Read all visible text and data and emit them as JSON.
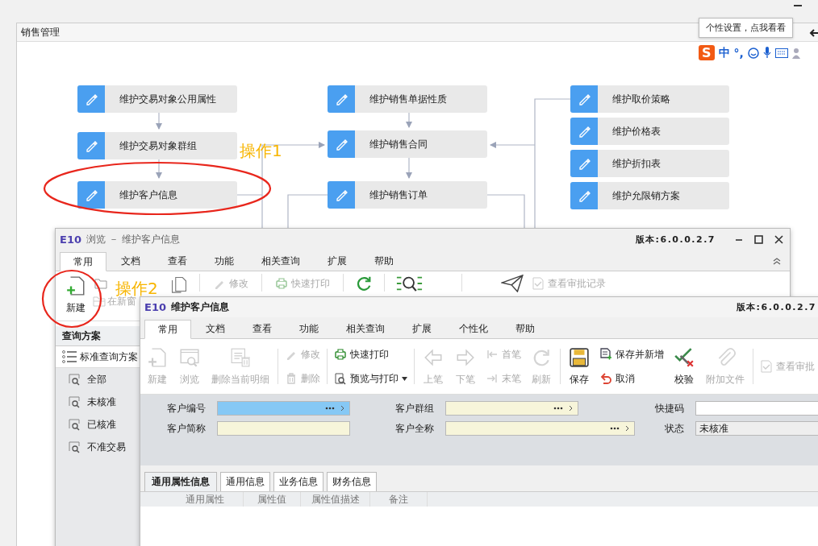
{
  "panel": {
    "title": "销售管理"
  },
  "tooltip": {
    "text": "个性设置，点我看看"
  },
  "ime_bar": {
    "logo": "S",
    "mode": "中",
    "punctuation": "°,"
  },
  "flow": {
    "columns": [
      {
        "nodes": [
          {
            "label": "维护交易对象公用属性"
          },
          {
            "label": "维护交易对象群组"
          },
          {
            "label": "维护客户信息"
          }
        ]
      },
      {
        "nodes": [
          {
            "label": "维护销售单据性质"
          },
          {
            "label": "维护销售合同"
          },
          {
            "label": "维护销售订单"
          }
        ]
      },
      {
        "nodes": [
          {
            "label": "维护取价策略"
          },
          {
            "label": "维护价格表"
          },
          {
            "label": "维护折扣表"
          },
          {
            "label": "维护允限销方案"
          }
        ]
      }
    ]
  },
  "annotations": [
    {
      "text": "操作1"
    },
    {
      "text": "操作2"
    }
  ],
  "browse_window": {
    "logo": "E10",
    "title": "浏览 － 维护客户信息",
    "version": "版本:6.0.0.2.7",
    "tabs": [
      {
        "label": "常用",
        "selected": true
      },
      {
        "label": "文档",
        "selected": false
      },
      {
        "label": "查看",
        "selected": false
      },
      {
        "label": "功能",
        "selected": false
      },
      {
        "label": "相关查询",
        "selected": false
      },
      {
        "label": "扩展",
        "selected": false
      },
      {
        "label": "帮助",
        "selected": false
      }
    ],
    "toolbar": [
      {
        "label": "新建",
        "disabled": false
      },
      {
        "label": "在新窗",
        "disabled": true
      },
      {
        "label": "修改",
        "disabled": true
      },
      {
        "label": "快速打印",
        "disabled": true
      },
      {
        "label": "查看审批记录",
        "disabled": true
      }
    ],
    "query_panel": {
      "title": "查询方案",
      "scheme": "标准查询方案",
      "items": [
        {
          "label": "全部"
        },
        {
          "label": "未核准"
        },
        {
          "label": "已核准"
        },
        {
          "label": "不准交易"
        }
      ]
    }
  },
  "edit_window": {
    "logo": "E10",
    "title": "维护客户信息",
    "version": "版本:6.0.0.2.7",
    "tabs": [
      {
        "label": "常用",
        "selected": true
      },
      {
        "label": "文档",
        "selected": false
      },
      {
        "label": "查看",
        "selected": false
      },
      {
        "label": "功能",
        "selected": false
      },
      {
        "label": "相关查询",
        "selected": false
      },
      {
        "label": "扩展",
        "selected": false
      },
      {
        "label": "个性化",
        "selected": false
      },
      {
        "label": "帮助",
        "selected": false
      }
    ],
    "toolbar_groups": [
      {
        "items": [
          {
            "label": "新建",
            "kind": "large",
            "disabled": true
          },
          {
            "label": "浏览",
            "kind": "large",
            "disabled": true
          },
          {
            "label": "删除当前明细",
            "kind": "large",
            "disabled": true
          }
        ]
      },
      {
        "items": [
          {
            "label": "修改",
            "kind": "small",
            "disabled": true
          },
          {
            "label": "删除",
            "kind": "small",
            "disabled": true
          }
        ]
      },
      {
        "items": [
          {
            "label": "快速打印",
            "kind": "small",
            "disabled": false
          },
          {
            "label": "预览与打印",
            "kind": "small",
            "disabled": false
          }
        ]
      },
      {
        "items": [
          {
            "label": "上笔",
            "kind": "large",
            "disabled": true
          },
          {
            "label": "下笔",
            "kind": "large",
            "disabled": true
          },
          {
            "label": "首笔",
            "kind": "small",
            "disabled": true
          },
          {
            "label": "末笔",
            "kind": "small",
            "disabled": true
          },
          {
            "label": "刷新",
            "kind": "large",
            "disabled": true
          }
        ]
      },
      {
        "items": [
          {
            "label": "保存",
            "kind": "large",
            "disabled": false
          },
          {
            "label": "保存并新增",
            "kind": "small",
            "disabled": false
          },
          {
            "label": "取消",
            "kind": "small",
            "disabled": false
          },
          {
            "label": "校验",
            "kind": "large",
            "disabled": false
          },
          {
            "label": "附加文件",
            "kind": "large",
            "disabled": true
          }
        ]
      },
      {
        "items": [
          {
            "label": "查看审批",
            "kind": "small",
            "disabled": true
          }
        ]
      }
    ],
    "form_rows": [
      [
        {
          "label": "客户编号",
          "kind": "required",
          "lookup": true,
          "focused": true
        },
        {
          "label": "客户群组",
          "kind": "required",
          "lookup": true,
          "focused": false
        },
        {
          "label": "快捷码",
          "kind": "optional",
          "lookup": false,
          "focused": false
        }
      ],
      [
        {
          "label": "客户简称",
          "kind": "required",
          "lookup": false,
          "focused": false
        },
        {
          "label": "客户全称",
          "kind": "required",
          "lookup": true,
          "focused": false
        },
        {
          "label": "状态",
          "kind": "readonly",
          "lookup": false,
          "focused": false,
          "value": "未核准"
        }
      ]
    ],
    "sub_tabs": [
      {
        "label": "通用属性信息",
        "selected": true
      },
      {
        "label": "通用信息",
        "selected": false
      },
      {
        "label": "业务信息",
        "selected": false
      },
      {
        "label": "财务信息",
        "selected": false
      }
    ],
    "grid_columns": [
      "通用属性",
      "属性值",
      "属性值描述",
      "备注"
    ]
  }
}
